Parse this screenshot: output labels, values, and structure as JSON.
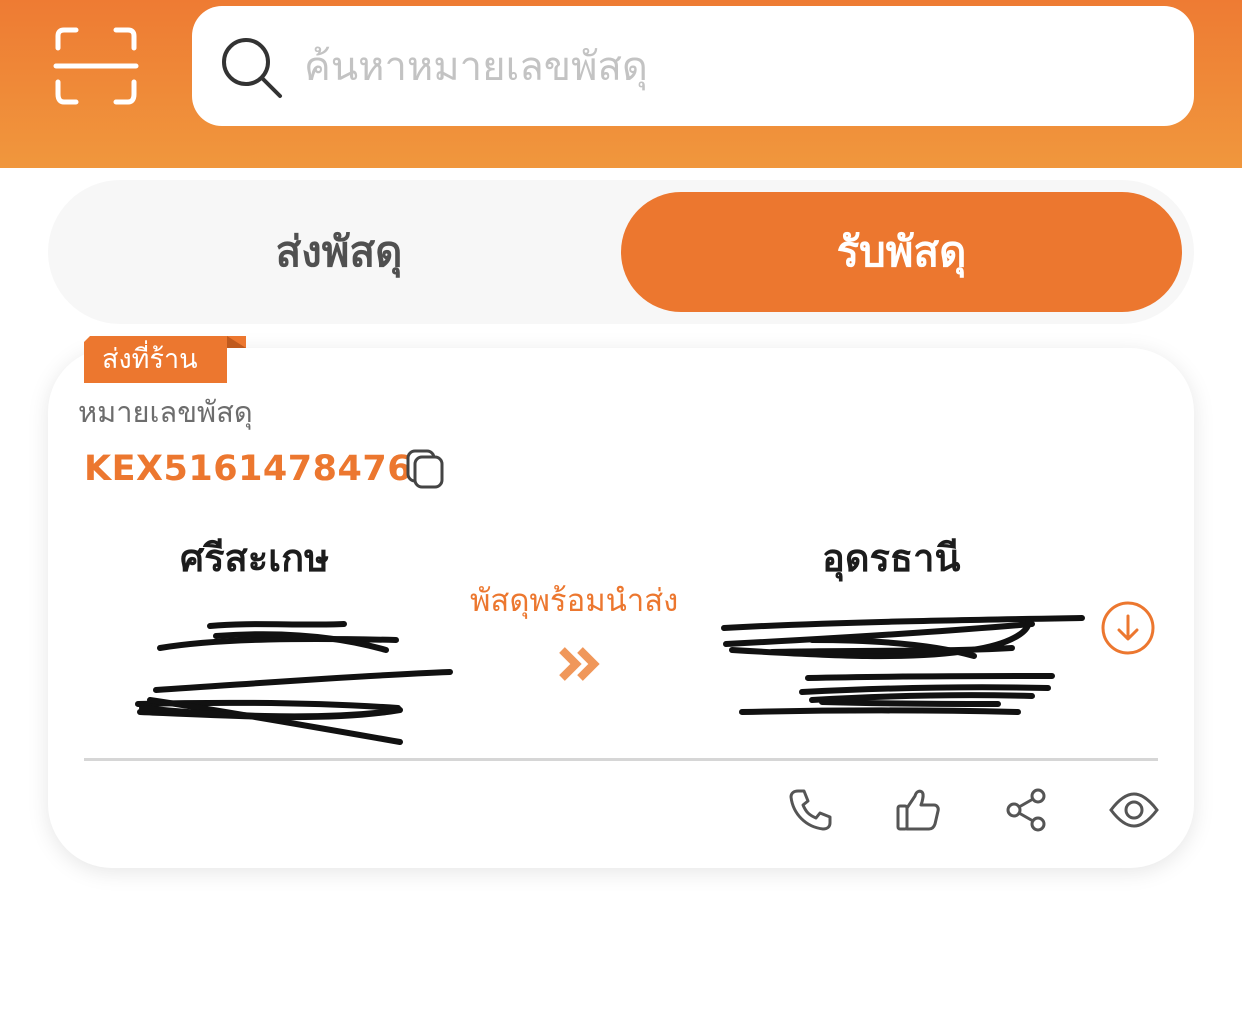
{
  "header": {
    "scan_icon": "scan-icon",
    "search": {
      "placeholder": "ค้นหาหมายเลขพัสดุ",
      "icon": "search-icon"
    },
    "background_color": "#ee7b33"
  },
  "tabs": [
    {
      "label": "ส่งพัสดุ",
      "active": false
    },
    {
      "label": "รับพัสดุ",
      "active": true
    }
  ],
  "accent_color": "#ec772f",
  "parcel": {
    "badge": "ส่งที่ร้าน",
    "tracking_label": "หมายเลขพัสดุ",
    "tracking_number": "KEX51614784761",
    "origin_city": "ศรีสะเกษ",
    "destination_city": "อุดรธานี",
    "status": "พัสดุพร้อมนำส่ง"
  },
  "actions": [
    {
      "icon": "phone-icon"
    },
    {
      "icon": "thumbs-up-icon"
    },
    {
      "icon": "share-icon"
    },
    {
      "icon": "eye-icon"
    }
  ]
}
